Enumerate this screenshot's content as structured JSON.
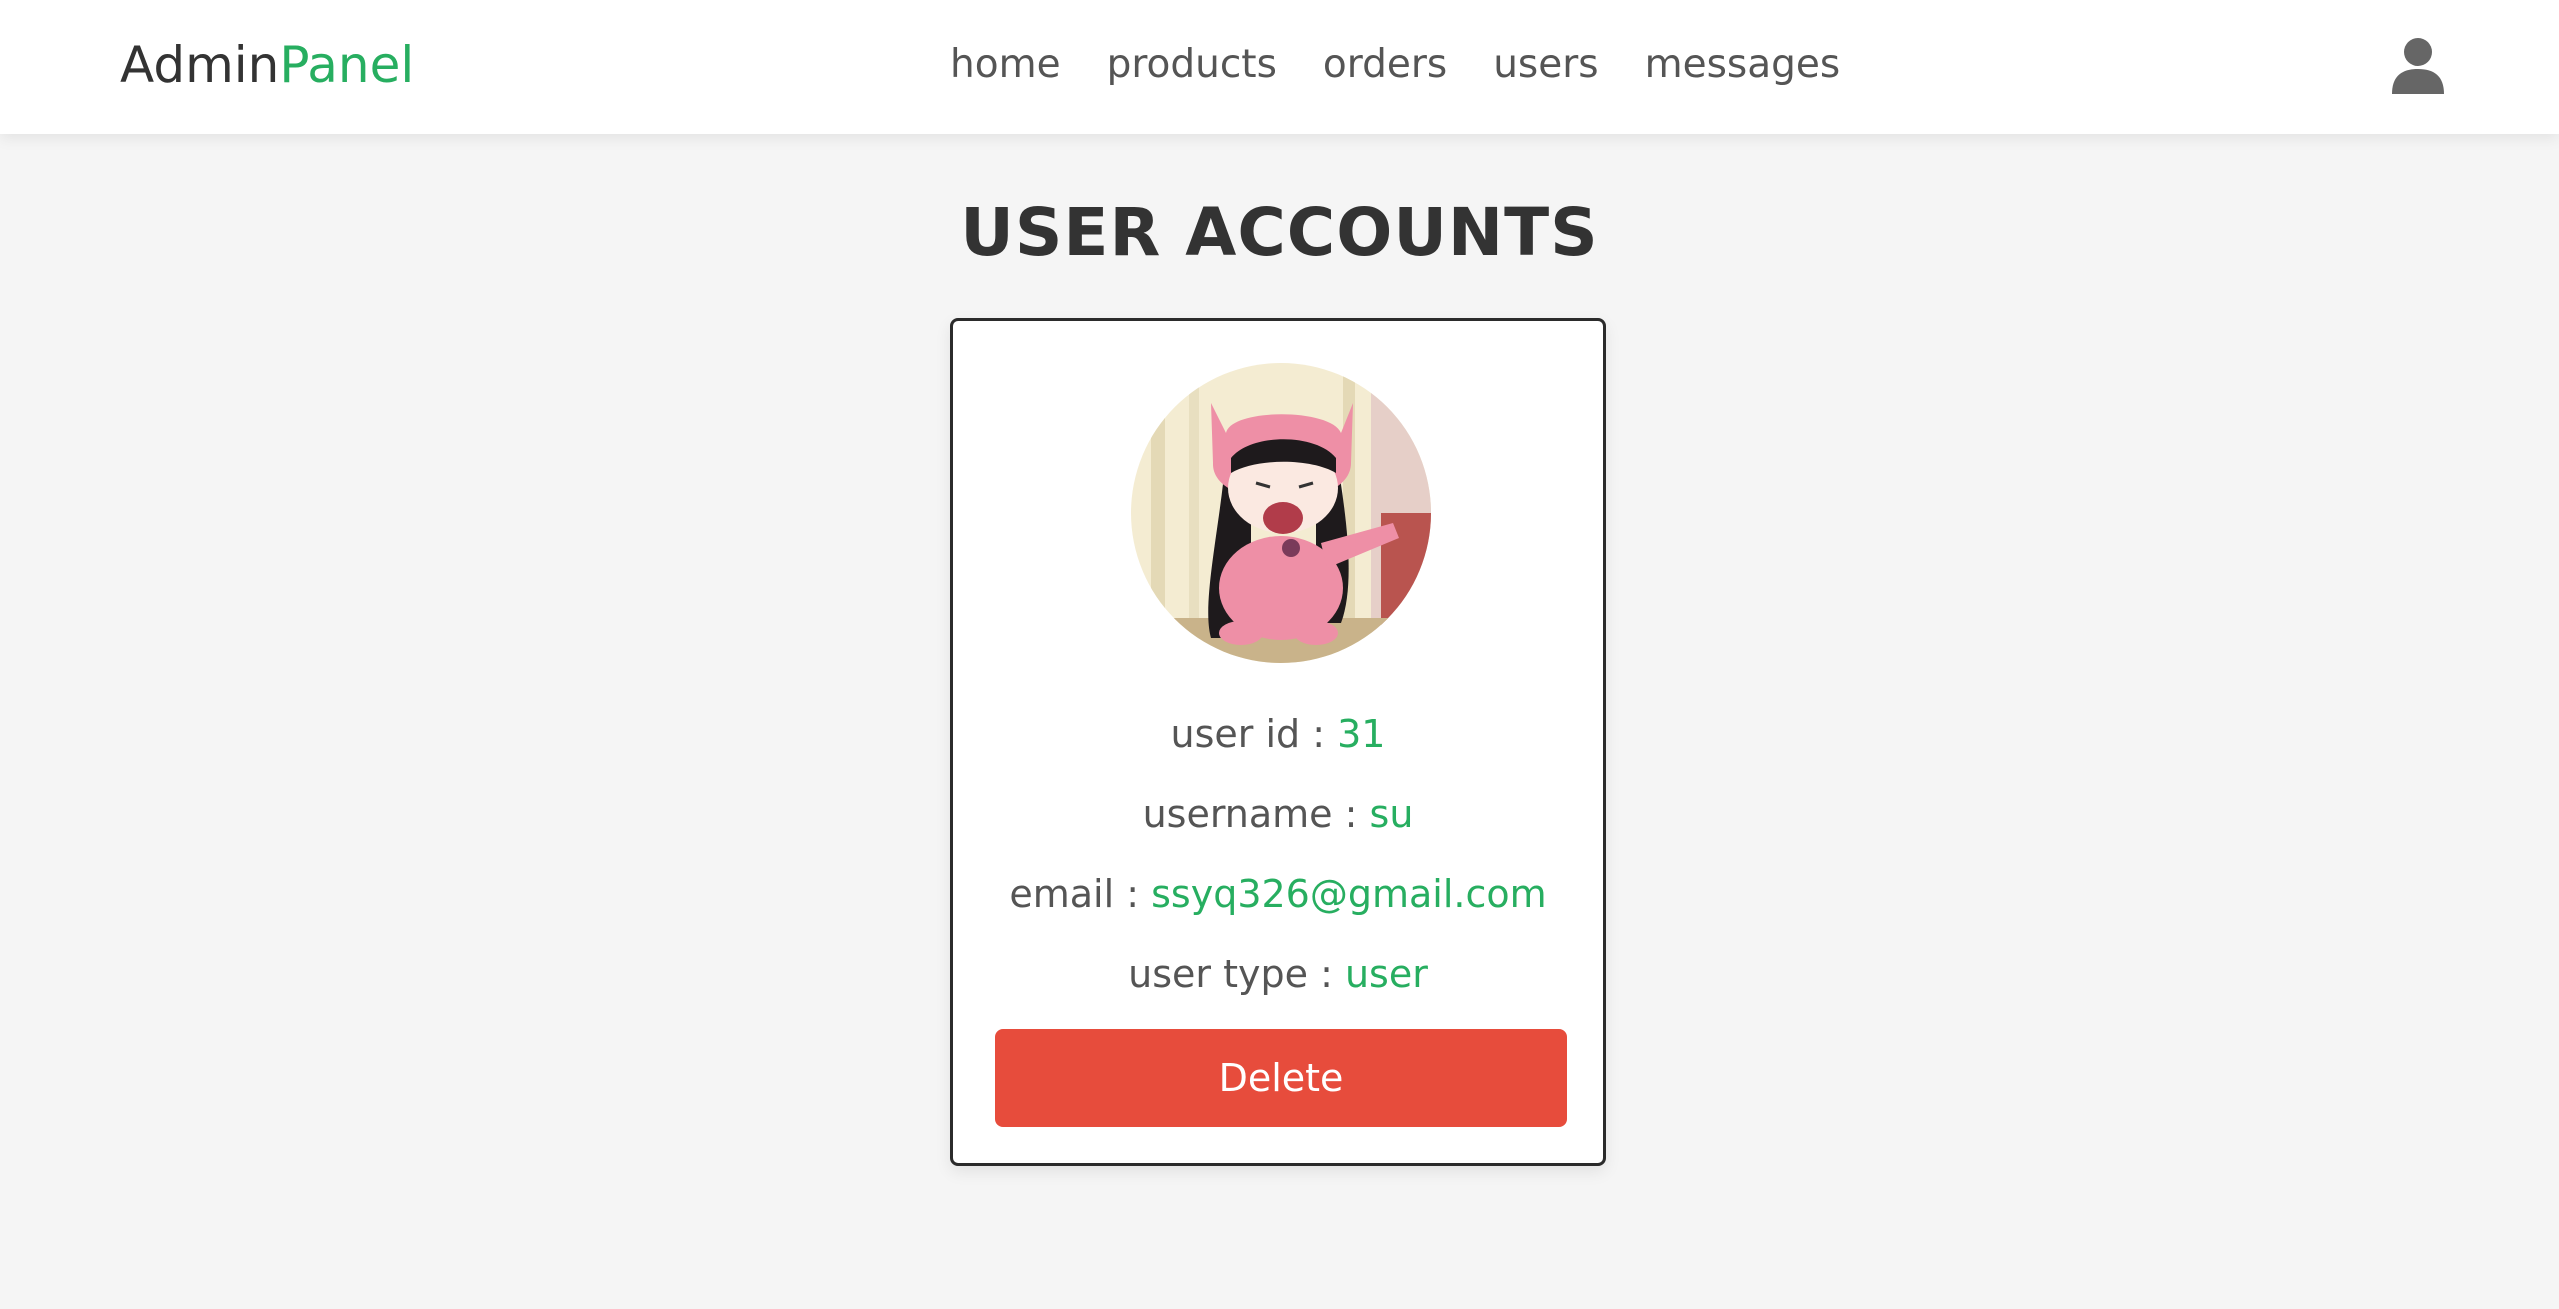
{
  "header": {
    "logo_part1": "Admin",
    "logo_part2": "Panel",
    "nav": [
      "home",
      "products",
      "orders",
      "users",
      "messages"
    ],
    "user_icon": "user-icon"
  },
  "page": {
    "title": "USER ACCOUNTS"
  },
  "user_card": {
    "avatar_icon": "avatar-image",
    "user_id_label": "user id : ",
    "user_id": "31",
    "username_label": "username : ",
    "username": "su",
    "email_label": "email : ",
    "email": "ssyq326@gmail.com",
    "user_type_label": "user type : ",
    "user_type": "user",
    "delete_label": "Delete"
  },
  "colors": {
    "accent": "#27ae60",
    "danger": "#e74c3c",
    "background": "#f5f5f5"
  }
}
